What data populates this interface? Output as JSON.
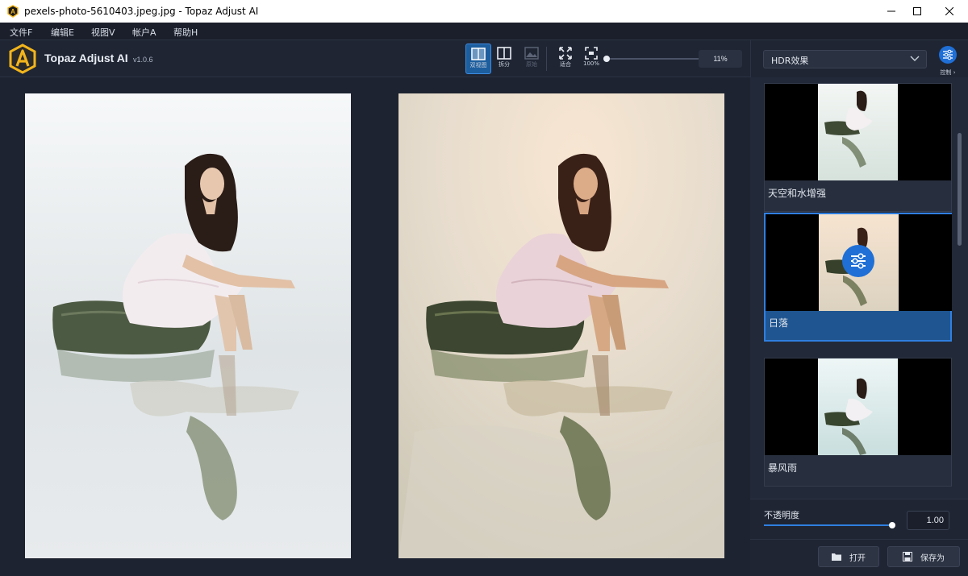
{
  "window": {
    "title": "pexels-photo-5610403.jpeg.jpg - Topaz Adjust AI",
    "controls": [
      "minimize",
      "maximize",
      "close"
    ]
  },
  "menu": {
    "items": [
      {
        "label": "文件F"
      },
      {
        "label": "编辑E"
      },
      {
        "label": "视图V"
      },
      {
        "label": "帐户A"
      },
      {
        "label": "帮助H"
      }
    ]
  },
  "toolbar": {
    "brand": "Topaz Adjust AI",
    "version": "v1.0.6",
    "view_buttons": [
      {
        "label": "双视图",
        "icon": "dual-view-icon",
        "state": "active"
      },
      {
        "label": "拆分",
        "icon": "split-view-icon",
        "state": "normal"
      },
      {
        "label": "原始",
        "icon": "original-image-icon",
        "state": "disabled"
      }
    ],
    "fit_label": "适合",
    "actual_label": "100%",
    "zoom_value": "11%",
    "zoom_level": 0.0
  },
  "sidebar": {
    "preset_dropdown": "HDR效果",
    "control_label": "控制",
    "presets": [
      {
        "label": "天空和水增强",
        "selected": false
      },
      {
        "label": "日落",
        "selected": true
      },
      {
        "label": "暴风雨",
        "selected": false
      }
    ],
    "opacity_label": "不透明度",
    "opacity_value": "1.00",
    "opacity_level": 1.0,
    "open_button": "打开",
    "save_button": "保存为"
  },
  "colors": {
    "accent": "#1f6fd6",
    "selection": "#1f5590",
    "logo": "#f2b51c"
  }
}
